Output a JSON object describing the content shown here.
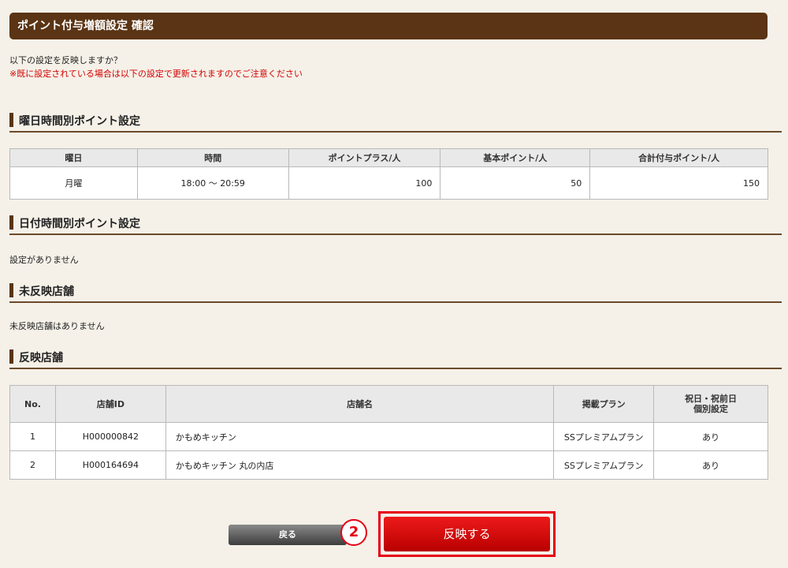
{
  "header": {
    "title": "ポイント付与増額設定 確認"
  },
  "intro": {
    "question": "以下の設定を反映しますか？",
    "warning": "※既に設定されている場合は以下の設定で更新されますのでご注意ください"
  },
  "weekday_section": {
    "title": "曜日時間別ポイント設定",
    "columns": [
      "曜日",
      "時間",
      "ポイントプラス/人",
      "基本ポイント/人",
      "合計付与ポイント/人"
    ],
    "rows": [
      {
        "day": "月曜",
        "time": "18:00 ～ 20:59",
        "plus": "100",
        "base": "50",
        "total": "150"
      }
    ]
  },
  "date_section": {
    "title": "日付時間別ポイント設定",
    "empty": "設定がありません"
  },
  "unreflected_section": {
    "title": "未反映店舗",
    "empty": "未反映店舗はありません"
  },
  "reflected_section": {
    "title": "反映店舗",
    "columns": [
      "No.",
      "店舗ID",
      "店舗名",
      "掲載プラン",
      "祝日・祝前日\n個別設定"
    ],
    "rows": [
      {
        "no": "1",
        "id": "H000000842",
        "name": "かもめキッチン",
        "plan": "SSプレミアムプラン",
        "holiday": "あり"
      },
      {
        "no": "2",
        "id": "H000164694",
        "name": "かもめキッチン 丸の内店",
        "plan": "SSプレミアムプラン",
        "holiday": "あり"
      }
    ]
  },
  "buttons": {
    "back": "戻る",
    "apply": "反映する",
    "step": "2"
  },
  "colors": {
    "header_bg": "#5a3414",
    "warning": "#d40000",
    "apply": "#e60012"
  }
}
